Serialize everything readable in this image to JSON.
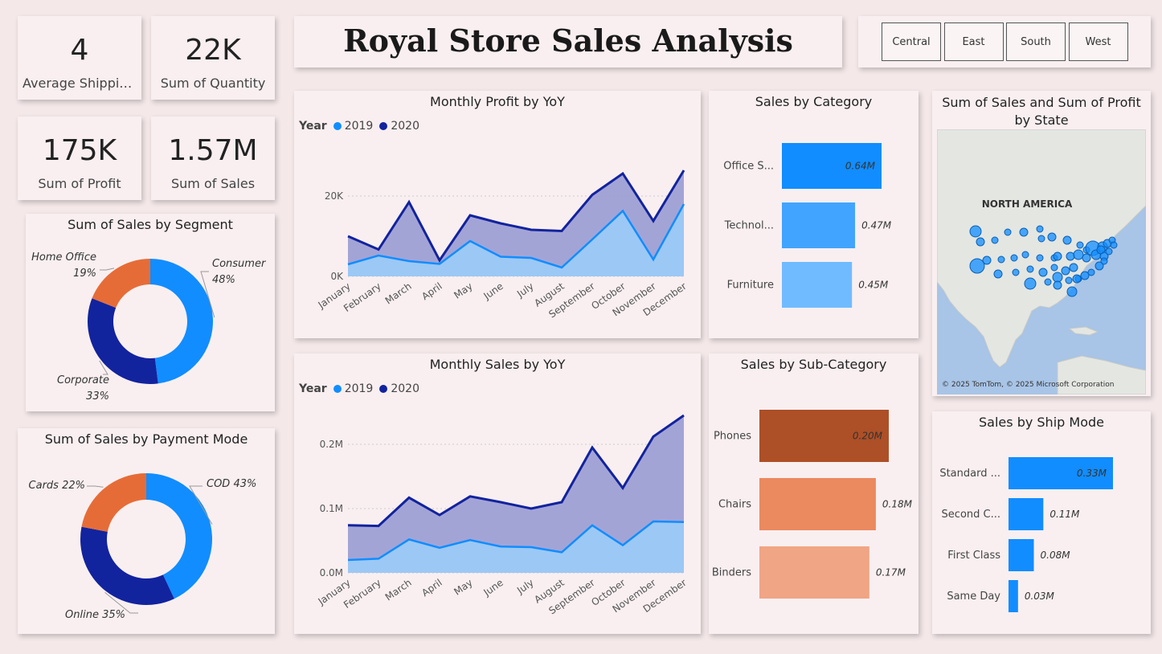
{
  "title": "Royal Store Sales Analysis",
  "kpis": {
    "avg_shipping": {
      "value": "4",
      "label": "Average Shippin..."
    },
    "sum_quantity": {
      "value": "22K",
      "label": "Sum of Quantity"
    },
    "sum_profit": {
      "value": "175K",
      "label": "Sum of Profit"
    },
    "sum_sales": {
      "value": "1.57M",
      "label": "Sum of Sales"
    }
  },
  "slicer": {
    "regions": [
      "Central",
      "East",
      "South",
      "West"
    ]
  },
  "colors": {
    "y2019": "#118dff",
    "y2020": "#12239e",
    "area2019": "#9ccaf7",
    "area2020": "#9e9fd4",
    "donut_blue": "#118dff",
    "donut_navy": "#12239e",
    "donut_orange": "#e66c37"
  },
  "legend": {
    "year_label": "Year",
    "y2019": "2019",
    "y2020": "2020"
  },
  "chart_data": [
    {
      "id": "monthly_profit",
      "type": "area",
      "title": "Monthly Profit by YoY",
      "categories": [
        "January",
        "February",
        "March",
        "April",
        "May",
        "June",
        "July",
        "August",
        "September",
        "October",
        "November",
        "December"
      ],
      "series": [
        {
          "name": "2019",
          "values": [
            3000,
            5200,
            3800,
            3100,
            8800,
            4900,
            4600,
            2200,
            9200,
            16300,
            4200,
            18000
          ]
        },
        {
          "name": "2020",
          "values": [
            10000,
            6700,
            18500,
            4000,
            15200,
            13200,
            11600,
            11300,
            20300,
            25600,
            13800,
            26400
          ]
        }
      ],
      "y_ticks": [
        {
          "v": 0,
          "label": "0K"
        },
        {
          "v": 20000,
          "label": "20K"
        }
      ],
      "ylim": [
        0,
        30000
      ]
    },
    {
      "id": "monthly_sales",
      "type": "area",
      "title": "Monthly Sales by YoY",
      "categories": [
        "January",
        "February",
        "March",
        "April",
        "May",
        "June",
        "July",
        "August",
        "September",
        "October",
        "November",
        "December"
      ],
      "series": [
        {
          "name": "2019",
          "values": [
            0.02,
            0.022,
            0.052,
            0.039,
            0.051,
            0.041,
            0.04,
            0.032,
            0.074,
            0.043,
            0.08,
            0.079
          ]
        },
        {
          "name": "2020",
          "values": [
            0.074,
            0.073,
            0.117,
            0.09,
            0.119,
            0.11,
            0.1,
            0.11,
            0.195,
            0.132,
            0.212,
            0.245
          ]
        }
      ],
      "y_ticks": [
        {
          "v": 0,
          "label": "0.0M"
        },
        {
          "v": 0.1,
          "label": "0.1M"
        },
        {
          "v": 0.2,
          "label": "0.2M"
        }
      ],
      "ylim": [
        0,
        0.27
      ]
    },
    {
      "id": "sales_by_segment",
      "type": "pie",
      "title": "Sum of Sales by Segment",
      "slices": [
        {
          "name": "Consumer",
          "value": 48,
          "label": "48%",
          "color": "#118dff"
        },
        {
          "name": "Corporate",
          "value": 33,
          "label": "33%",
          "color": "#12239e"
        },
        {
          "name": "Home Office",
          "value": 19,
          "label": "19%",
          "color": "#e66c37"
        }
      ]
    },
    {
      "id": "sales_by_payment",
      "type": "pie",
      "title": "Sum of Sales by Payment Mode",
      "slices": [
        {
          "name": "COD",
          "value": 43,
          "label": "COD 43%",
          "color": "#118dff"
        },
        {
          "name": "Online",
          "value": 35,
          "label": "Online 35%",
          "color": "#12239e"
        },
        {
          "name": "Cards",
          "value": 22,
          "label": "Cards 22%",
          "color": "#e66c37"
        }
      ]
    },
    {
      "id": "sales_by_category",
      "type": "bar",
      "title": "Sales by Category",
      "categories": [
        "Office S...",
        "Technol...",
        "Furniture"
      ],
      "values": [
        0.64,
        0.47,
        0.45
      ],
      "labels": [
        "0.64M",
        "0.47M",
        "0.45M"
      ],
      "colors": [
        "#118dff",
        "#41a4ff",
        "#70bbff"
      ],
      "xlim": [
        0,
        0.64
      ]
    },
    {
      "id": "sales_by_subcategory",
      "type": "bar",
      "title": "Sales by Sub-Category",
      "categories": [
        "Phones",
        "Chairs",
        "Binders"
      ],
      "values": [
        0.2,
        0.18,
        0.17
      ],
      "labels": [
        "0.20M",
        "0.18M",
        "0.17M"
      ],
      "colors": [
        "#ad4f27",
        "#eb895f",
        "#f0a585"
      ],
      "xlim": [
        0,
        0.2
      ]
    },
    {
      "id": "sales_by_shipmode",
      "type": "bar",
      "title": "Sales by Ship Mode",
      "categories": [
        "Standard ...",
        "Second C...",
        "First Class",
        "Same Day"
      ],
      "values": [
        0.33,
        0.11,
        0.08,
        0.03
      ],
      "labels": [
        "0.33M",
        "0.11M",
        "0.08M",
        "0.03M"
      ],
      "colors": [
        "#118dff",
        "#118dff",
        "#118dff",
        "#118dff"
      ],
      "xlim": [
        0,
        0.33
      ]
    }
  ],
  "map": {
    "title": "Sum of Sales and Sum of Profit by State",
    "region_label": "NORTH AMERICA",
    "attribution": "© 2025 TomTom, © 2025 Microsoft Corporation"
  }
}
